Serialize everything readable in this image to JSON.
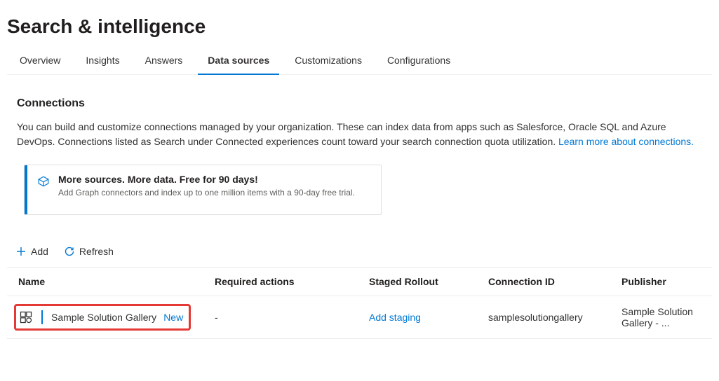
{
  "pageTitle": "Search & intelligence",
  "tabs": [
    {
      "label": "Overview"
    },
    {
      "label": "Insights"
    },
    {
      "label": "Answers"
    },
    {
      "label": "Data sources"
    },
    {
      "label": "Customizations"
    },
    {
      "label": "Configurations"
    }
  ],
  "sectionTitle": "Connections",
  "descriptionMain": "You can build and customize connections managed by your organization. These can index data from apps such as Salesforce, Oracle SQL and Azure DevOps. Connections listed as Search under Connected experiences count toward your search connection quota utilization. ",
  "descriptionLink": "Learn more about connections.",
  "infoCard": {
    "title": "More sources. More data. Free for 90 days!",
    "subtitle": "Add Graph connectors and index up to one million items with a 90-day free trial."
  },
  "toolbar": {
    "add": "Add",
    "refresh": "Refresh"
  },
  "columns": {
    "name": "Name",
    "required": "Required actions",
    "staged": "Staged Rollout",
    "connId": "Connection ID",
    "publisher": "Publisher"
  },
  "row": {
    "name": "Sample Solution Gallery",
    "badge": "New",
    "required": "-",
    "staged": "Add staging",
    "connId": "samplesolutiongallery",
    "publisher": "Sample Solution Gallery - ..."
  }
}
